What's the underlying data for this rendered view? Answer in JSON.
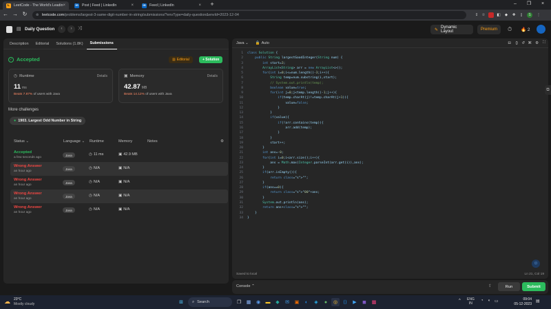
{
  "browser": {
    "tabs": [
      {
        "title": "LeetCode - The World's Leadin",
        "icon": "leetcode-icon",
        "active": true
      },
      {
        "title": "Post | Feed | LinkedIn",
        "icon": "linkedin-icon",
        "active": false
      },
      {
        "title": "Feed | LinkedIn",
        "icon": "linkedin-icon",
        "active": false
      }
    ],
    "url_host": "leetcode.com",
    "url_path": "/problems/largest-3-same-digit-number-in-string/submissions/?envType=daily-question&envId=2023-12-04"
  },
  "lcnav": {
    "title": "Daily Question",
    "layout_label": "Dynamic Layout",
    "premium_label": "Premium",
    "streak": "2"
  },
  "left": {
    "tabs": [
      "Description",
      "Editorial",
      "Solutions (1.8K)",
      "Submissions"
    ],
    "active_tab": "Submissions",
    "status": "Accepted",
    "editorial_btn": "Editorial",
    "solution_btn": "+ Solution",
    "runtime": {
      "label": "Runtime",
      "details": "Details",
      "value": "11",
      "unit": "ms",
      "beats_pct": "Beats 7.87%",
      "beats_rest": " of users with Java"
    },
    "memory": {
      "label": "Memory",
      "details": "Details",
      "value": "42.87",
      "unit": "MB",
      "beats_pct": "Beats 14.12%",
      "beats_rest": " of users with Java"
    },
    "more_title": "More challenges",
    "challenge": "1903. Largest Odd Number in String",
    "columns": [
      "Status",
      "Language",
      "Runtime",
      "Memory",
      "Notes"
    ],
    "rows": [
      {
        "status": "Accepted",
        "when": "a few seconds ago",
        "lang": "Java",
        "runtime": "11 ms",
        "memory": "42.9 MB"
      },
      {
        "status": "Wrong Answer",
        "when": "an hour ago",
        "lang": "Java",
        "runtime": "N/A",
        "memory": "N/A"
      },
      {
        "status": "Wrong Answer",
        "when": "an hour ago",
        "lang": "Java",
        "runtime": "N/A",
        "memory": "N/A"
      },
      {
        "status": "Wrong Answer",
        "when": "an hour ago",
        "lang": "Java",
        "runtime": "N/A",
        "memory": "N/A"
      },
      {
        "status": "Wrong Answer",
        "when": "an hour ago",
        "lang": "Java",
        "runtime": "N/A",
        "memory": "N/A"
      }
    ]
  },
  "editor": {
    "language": "Java",
    "mode": "Auto",
    "saved": "Saved to local",
    "cursor": "Ln 21, Col 19",
    "code": [
      "class Solution {",
      "    public String largestGoodInteger(String num) {",
      "        int start=3;",
      "        ArrayList<String> arr = new ArrayList<>();",
      "        for(int i=0;i<=num.length()-3;i++){",
      "            String temp=num.substring(i,start);",
      "            // System.out.println(temp);",
      "            boolean value=true;",
      "            for(int j=0;j<temp.length()-1;j++){",
      "                if(temp.charAt(j)!=temp.charAt(j+1)){",
      "                    value=false;",
      "                }",
      "            }",
      "            if(value){",
      "                if(!arr.contains(temp)){",
      "                    arr.add(temp);",
      "                }",
      "            }",
      "            start++;",
      "        }",
      "        int ans=-0;",
      "        for(int i=0;i<arr.size();i++){",
      "            ans = Math.max(Integer.parseInt(arr.get(i)),ans);",
      "        }",
      "        if(arr.isEmpty()){",
      "            return \"\";",
      "        }",
      "        if(ans==0){",
      "            return \"00\"+ans;",
      "        }",
      "        System.out.println(ans);",
      "        return ans+\"\";",
      "    }",
      "}"
    ]
  },
  "console": {
    "label": "Console",
    "run": "Run",
    "submit": "Submit"
  },
  "taskbar": {
    "weather_temp": "23°C",
    "weather_desc": "Mostly cloudy",
    "search": "Search",
    "lang": "ENG",
    "region": "IN",
    "time": "09:04",
    "date": "05-12-2023"
  },
  "colors": {
    "accepted": "#2cbb5d",
    "wrong": "#ef4743",
    "submit": "#2cbb5d",
    "premium": "#ffa116"
  }
}
